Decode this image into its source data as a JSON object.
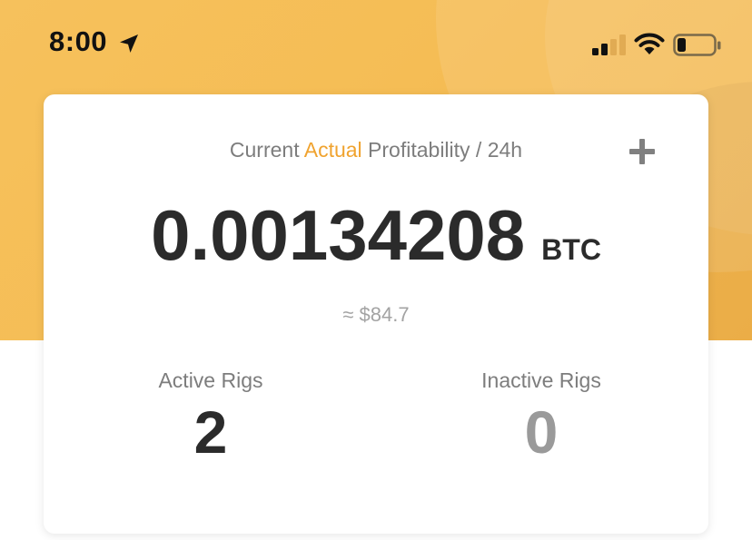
{
  "status_bar": {
    "time": "8:00",
    "icons": [
      "location-arrow-icon",
      "cellular-signal-icon",
      "wifi-icon",
      "battery-icon"
    ]
  },
  "colors": {
    "header_gradient_start": "#f6c15c",
    "header_gradient_end": "#f3b34a",
    "accent": "#f0a32f",
    "primary_text": "#2b2b2b",
    "secondary_text": "#7d7d7d",
    "muted_text": "#a3a3a3"
  },
  "card": {
    "title_prefix": "Current ",
    "title_accent": "Actual",
    "title_suffix": " Profitability / 24h",
    "add_icon": "plus-icon",
    "profitability_value": "0.00134208",
    "profitability_unit": "BTC",
    "usd_equivalent": "≈ $84.7",
    "active_rigs_label": "Active Rigs",
    "active_rigs_count": "2",
    "inactive_rigs_label": "Inactive Rigs",
    "inactive_rigs_count": "0"
  }
}
